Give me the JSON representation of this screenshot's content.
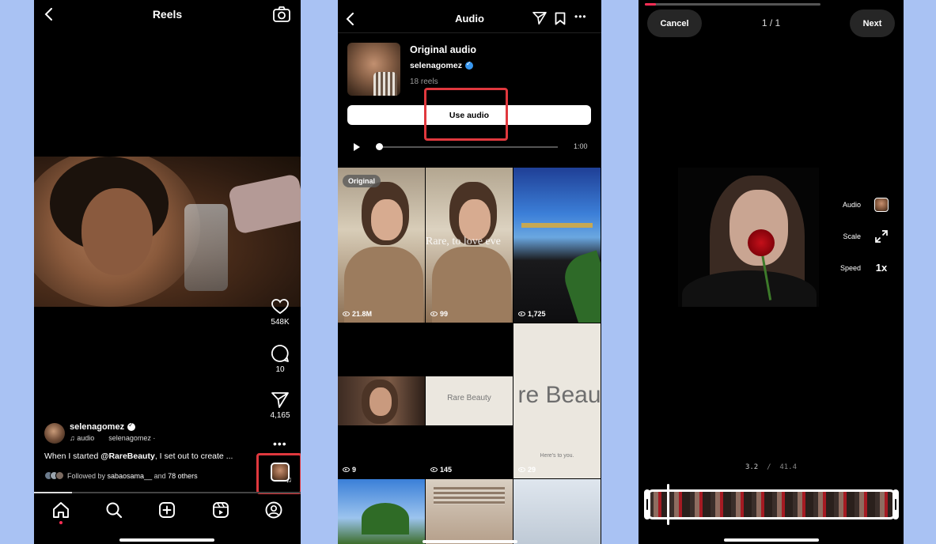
{
  "reels": {
    "title": "Reels",
    "likes": "548K",
    "comments": "10",
    "shares": "4,165",
    "username": "selenagomez",
    "audio_label": "audio",
    "audio_artist": "selenagomez ·",
    "caption_prefix": "When I started ",
    "caption_mention": "@RareBeauty",
    "caption_rest": ", I set out to create ...",
    "followed_prefix": "Followed by ",
    "followed_user": "sabaosama__",
    "followed_and": " and ",
    "followed_others": "78 others"
  },
  "audio": {
    "title": "Audio",
    "name": "Original audio",
    "artist": "selenagomez",
    "reels_count": "18 reels",
    "use_label": "Use audio",
    "duration": "1:00",
    "grid": [
      {
        "badge": "Original",
        "views": "21.8M"
      },
      {
        "views": "99",
        "overlay": "Rare, to love eve"
      },
      {
        "views": "1,725"
      },
      {
        "views": "9"
      },
      {
        "views": "145",
        "overlay": "Rare Beauty"
      },
      {
        "views": "29",
        "overlay": "re Beau",
        "sub": "Here's to you."
      }
    ]
  },
  "editor": {
    "cancel": "Cancel",
    "counter": "1 / 1",
    "next": "Next",
    "options": [
      {
        "label": "Audio",
        "icon": "audio-thumbnail-icon"
      },
      {
        "label": "Scale",
        "icon": "scale-expand-icon"
      },
      {
        "label": "Speed",
        "icon": "speed-icon",
        "value": "1x"
      }
    ],
    "time_current": "3.2",
    "time_sep": "/",
    "time_total": "41.4"
  },
  "colors": {
    "highlight": "#e0383e",
    "background": "#a9c2f3",
    "verified": "#3897f0",
    "accent": "#ff2d55"
  }
}
